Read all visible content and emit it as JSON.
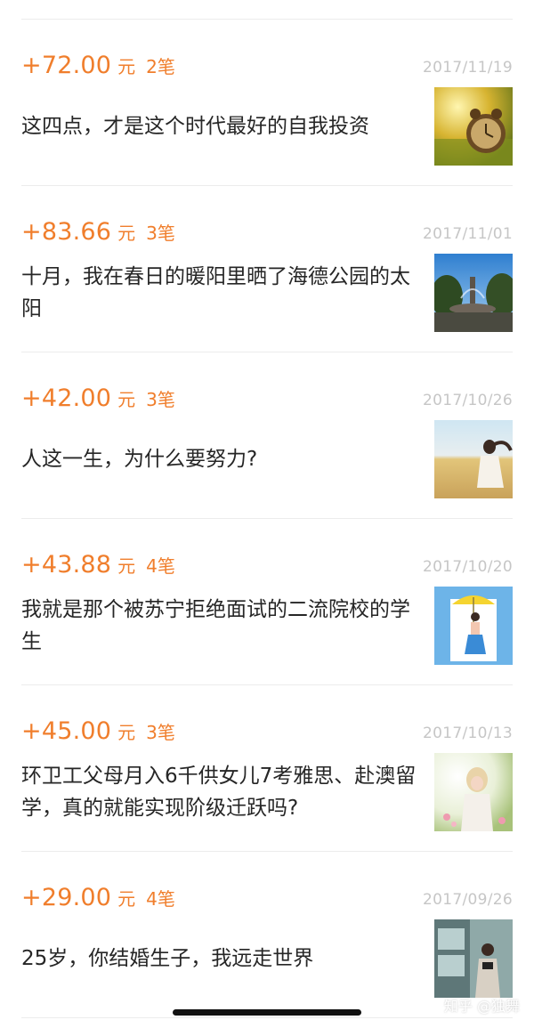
{
  "items": [
    {
      "amount": "+72.00",
      "unit": "元",
      "count": "2笔",
      "date": "2017/11/19",
      "title": "这四点，才是这个时代最好的自我投资",
      "thumb_icon": "alarm-clock-grass-photo"
    },
    {
      "amount": "+83.66",
      "unit": "元",
      "count": "3笔",
      "date": "2017/11/01",
      "title": "十月，我在春日的暖阳里晒了海德公园的太阳",
      "thumb_icon": "park-fountain-photo"
    },
    {
      "amount": "+42.00",
      "unit": "元",
      "count": "3笔",
      "date": "2017/10/26",
      "title": "人这一生，为什么要努力?",
      "thumb_icon": "girl-in-wheat-field-photo"
    },
    {
      "amount": "+43.88",
      "unit": "元",
      "count": "4笔",
      "date": "2017/10/20",
      "title": "我就是那个被苏宁拒绝面试的二流院校的学生",
      "thumb_icon": "girl-with-umbrella-illustration"
    },
    {
      "amount": "+45.00",
      "unit": "元",
      "count": "3笔",
      "date": "2017/10/13",
      "title": "环卫工父母月入6千供女儿7考雅思、赴澳留学，真的就能实现阶级迁跃吗?",
      "thumb_icon": "girl-in-flowers-photo"
    },
    {
      "amount": "+29.00",
      "unit": "元",
      "count": "4笔",
      "date": "2017/09/26",
      "title": "25岁，你结婚生子，我远走世界",
      "thumb_icon": "train-traveler-photo"
    }
  ],
  "watermark": "知乎 @独舞"
}
